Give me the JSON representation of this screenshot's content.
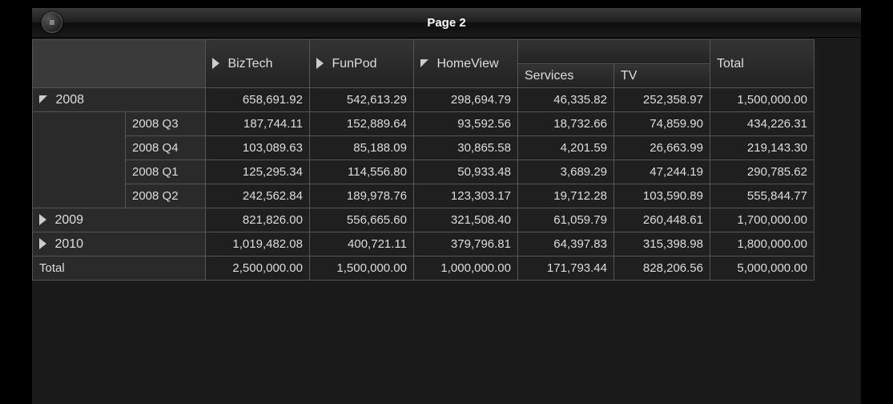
{
  "title": "Page 2",
  "menu_icon": "≡",
  "columns": {
    "biztech": "BizTech",
    "funpod": "FunPod",
    "homeview": "HomeView",
    "services": "Services",
    "tv": "TV",
    "total": "Total"
  },
  "rows": {
    "y2008": {
      "label": "2008",
      "biztech": "658,691.92",
      "funpod": "542,613.29",
      "homeview": "298,694.79",
      "services": "46,335.82",
      "tv": "252,358.97",
      "total": "1,500,000.00",
      "q3": {
        "label": "2008 Q3",
        "biztech": "187,744.11",
        "funpod": "152,889.64",
        "homeview": "93,592.56",
        "services": "18,732.66",
        "tv": "74,859.90",
        "total": "434,226.31"
      },
      "q4": {
        "label": "2008 Q4",
        "biztech": "103,089.63",
        "funpod": "85,188.09",
        "homeview": "30,865.58",
        "services": "4,201.59",
        "tv": "26,663.99",
        "total": "219,143.30"
      },
      "q1": {
        "label": "2008 Q1",
        "biztech": "125,295.34",
        "funpod": "114,556.80",
        "homeview": "50,933.48",
        "services": "3,689.29",
        "tv": "47,244.19",
        "total": "290,785.62"
      },
      "q2": {
        "label": "2008 Q2",
        "biztech": "242,562.84",
        "funpod": "189,978.76",
        "homeview": "123,303.17",
        "services": "19,712.28",
        "tv": "103,590.89",
        "total": "555,844.77"
      }
    },
    "y2009": {
      "label": "2009",
      "biztech": "821,826.00",
      "funpod": "556,665.60",
      "homeview": "321,508.40",
      "services": "61,059.79",
      "tv": "260,448.61",
      "total": "1,700,000.00"
    },
    "y2010": {
      "label": "2010",
      "biztech": "1,019,482.08",
      "funpod": "400,721.11",
      "homeview": "379,796.81",
      "services": "64,397.83",
      "tv": "315,398.98",
      "total": "1,800,000.00"
    },
    "grand": {
      "label": "Total",
      "biztech": "2,500,000.00",
      "funpod": "1,500,000.00",
      "homeview": "1,000,000.00",
      "services": "171,793.44",
      "tv": "828,206.56",
      "total": "5,000,000.00"
    }
  }
}
